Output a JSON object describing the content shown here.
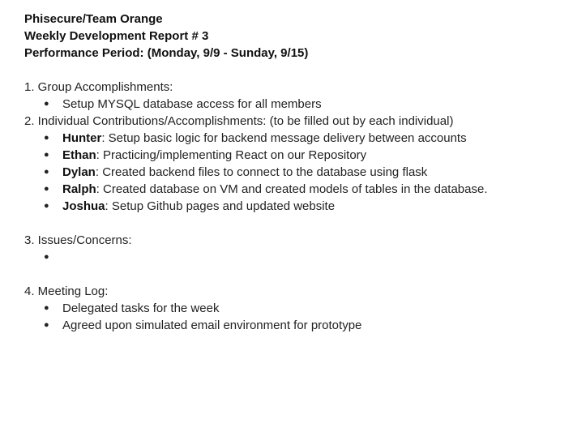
{
  "header": {
    "line1": "Phisecure/Team Orange",
    "line2": "Weekly Development Report # 3",
    "line3": "Performance Period: (Monday, 9/9 - Sunday, 9/15)"
  },
  "sections": {
    "group": {
      "heading": "1. Group Accomplishments:",
      "items": [
        "Setup MYSQL database access for all members"
      ]
    },
    "individual": {
      "heading": "2. Individual Contributions/Accomplishments: (to be filled out by each individual)",
      "items": [
        {
          "name": "Hunter",
          "text": ": Setup basic logic for backend message delivery between accounts"
        },
        {
          "name": "Ethan",
          "text": ": Practicing/implementing React on our Repository"
        },
        {
          "name": "Dylan",
          "text": ": Created backend files to connect to the database using flask"
        },
        {
          "name": "Ralph",
          "text": ": Created database on VM and created models of tables in the database."
        },
        {
          "name": "Joshua",
          "text": ": Setup Github pages and updated website"
        }
      ]
    },
    "issues": {
      "heading": "3. Issues/Concerns:",
      "items": [
        ""
      ]
    },
    "meeting": {
      "heading": "4. Meeting Log:",
      "items": [
        "Delegated tasks for the week",
        "Agreed upon simulated email environment for prototype"
      ]
    }
  },
  "bullet_glyph": "●"
}
